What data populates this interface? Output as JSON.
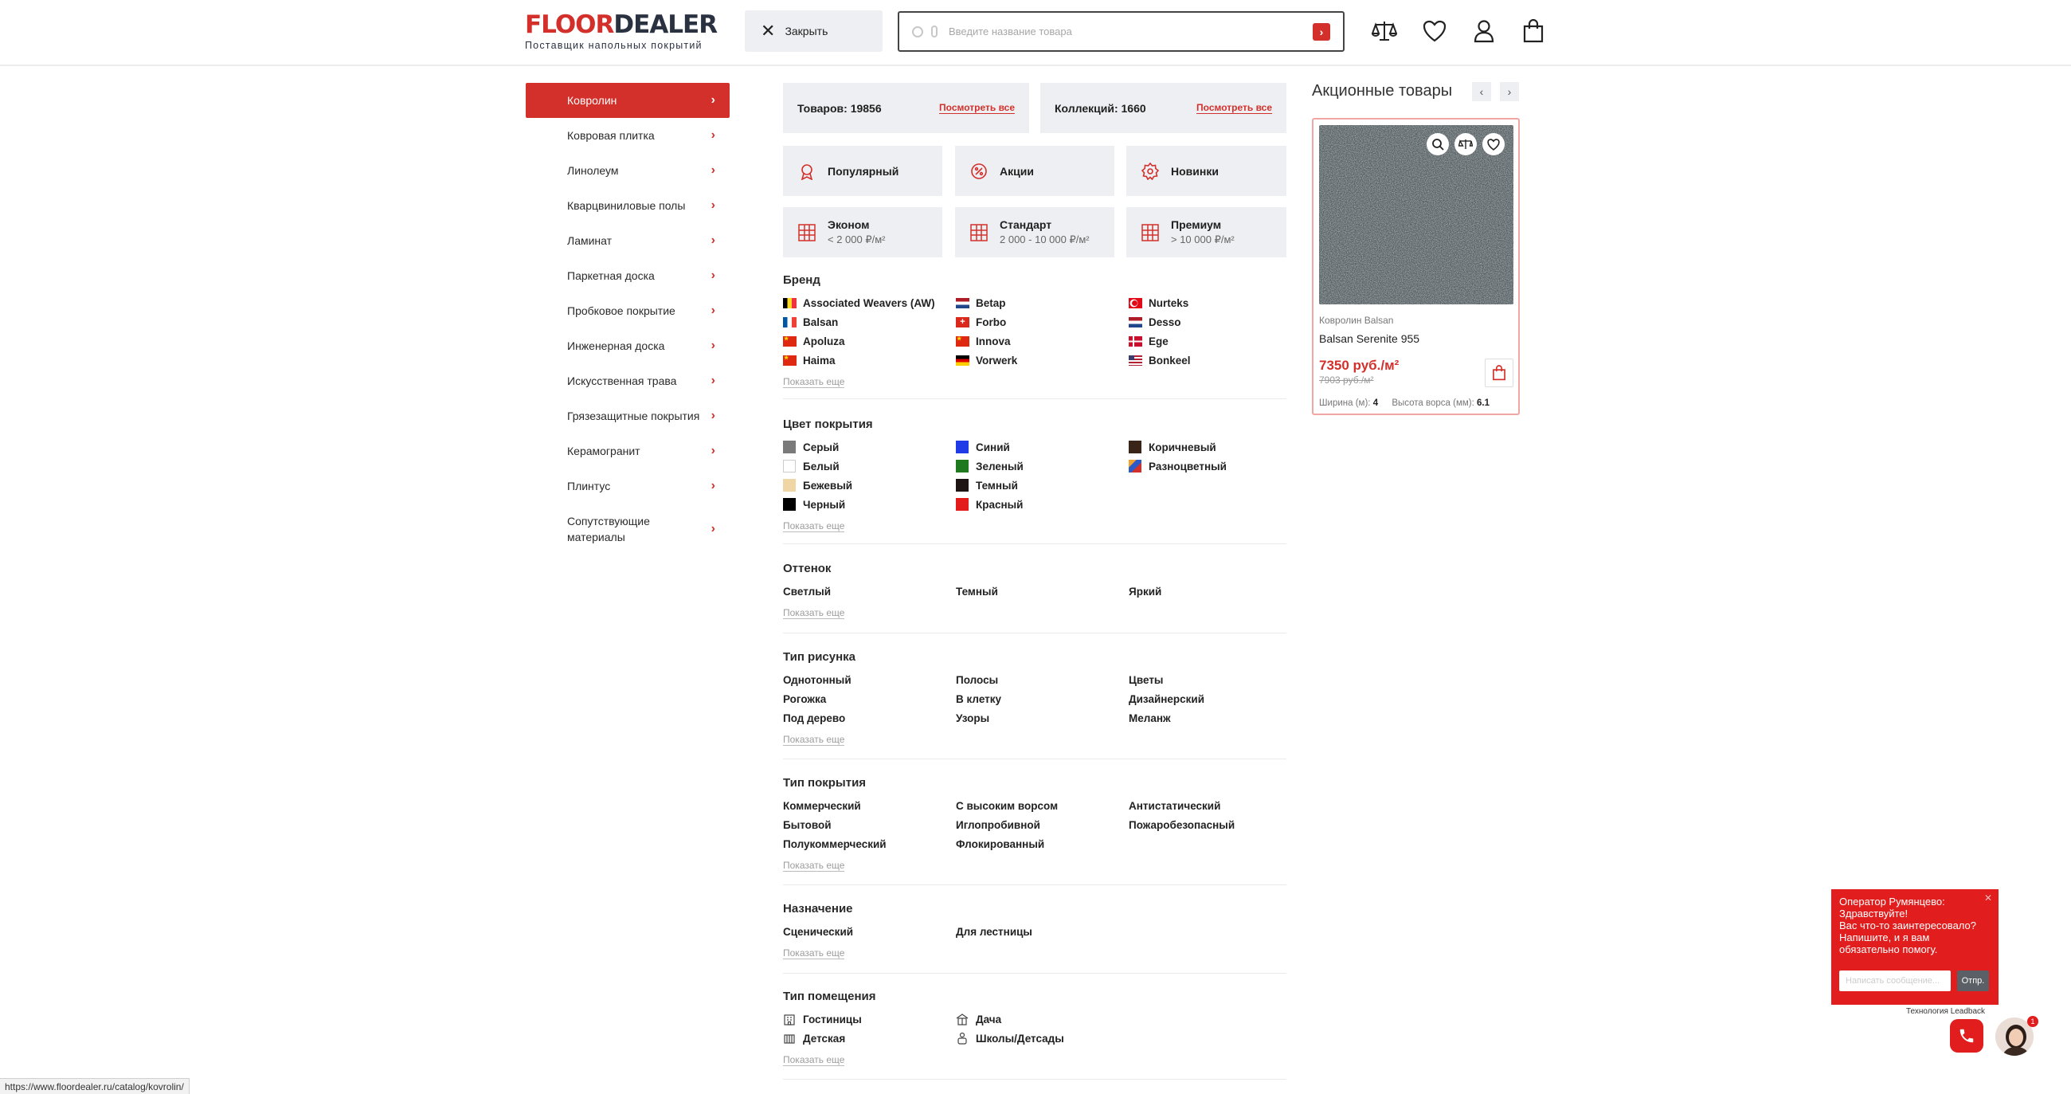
{
  "header": {
    "logo_part1": "FLOOR",
    "logo_part2": "DEALER",
    "tagline": "Поставщик напольных покрытий",
    "close_label": "Закрыть",
    "search_placeholder": "Введите название товара",
    "icons": [
      "compare-icon",
      "heart-icon",
      "user-icon",
      "cart-icon"
    ]
  },
  "sidebar": {
    "items": [
      {
        "label": "Ковролин",
        "active": true
      },
      {
        "label": "Ковровая плитка"
      },
      {
        "label": "Линолеум"
      },
      {
        "label": "Кварцвиниловые полы"
      },
      {
        "label": "Ламинат"
      },
      {
        "label": "Паркетная доска"
      },
      {
        "label": "Пробковое покрытие"
      },
      {
        "label": "Инженерная доска"
      },
      {
        "label": "Искусственная трава"
      },
      {
        "label": "Грязезащитные покрытия"
      },
      {
        "label": "Керамогранит"
      },
      {
        "label": "Плинтус"
      },
      {
        "label": "Сопутствующие материалы"
      }
    ]
  },
  "stats": {
    "goods": "Товаров: 19856",
    "goods_link": "Посмотреть все",
    "collections": "Коллекций: 1660",
    "collections_link": "Посмотреть все"
  },
  "chips": {
    "popular": "Популярный",
    "sales": "Акции",
    "new": "Новинки",
    "econom": "Эконом",
    "econom_sub": "< 2 000 ₽/м²",
    "standard": "Стандарт",
    "standard_sub": "2 000 - 10 000 ₽/м²",
    "premium": "Премиум",
    "premium_sub": "> 10 000 ₽/м²"
  },
  "filters": {
    "show_more": "Показать еще",
    "brand": {
      "title": "Бренд",
      "items": [
        "Associated Weavers (AW)",
        "Betap",
        "Nurteks",
        "Balsan",
        "Forbo",
        "Desso",
        "Apoluza",
        "Innova",
        "Ege",
        "Haima",
        "Vorwerk",
        "Bonkeel"
      ]
    },
    "color": {
      "title": "Цвет покрытия",
      "items": [
        {
          "label": "Серый",
          "color": "#7a7a7a"
        },
        {
          "label": "Синий",
          "color": "#1f3ae6"
        },
        {
          "label": "Коричневый",
          "color": "#3a2418"
        },
        {
          "label": "Белый",
          "color": "#ffffff"
        },
        {
          "label": "Зеленый",
          "color": "#1f7a1f"
        },
        {
          "label": "Разноцветный",
          "color": "multi"
        },
        {
          "label": "Бежевый",
          "color": "#f1d6a5"
        },
        {
          "label": "Темный",
          "color": "#1e1414"
        },
        {
          "label": "Черный",
          "color": "#000000"
        },
        {
          "label": "Красный",
          "color": "#e41b1b"
        }
      ]
    },
    "shade": {
      "title": "Оттенок",
      "items": [
        "Светлый",
        "Темный",
        "Яркий"
      ]
    },
    "pattern": {
      "title": "Тип рисунка",
      "items": [
        "Однотонный",
        "Полосы",
        "Цветы",
        "Рогожка",
        "В клетку",
        "Дизайнерский",
        "Под дерево",
        "Узоры",
        "Меланж"
      ]
    },
    "cover_type": {
      "title": "Тип покрытия",
      "items": [
        "Коммерческий",
        "С высоким ворсом",
        "Антистатический",
        "Бытовой",
        "Иглопробивной",
        "Пожаробезопасный",
        "Полукоммерческий",
        "Флокированный"
      ]
    },
    "purpose": {
      "title": "Назначение",
      "items": [
        "Сценический",
        "Для лестницы"
      ]
    },
    "room": {
      "title": "Тип помещения",
      "items": [
        "Гостиницы",
        "Дача",
        "Детская",
        "Школы/Детсады"
      ]
    }
  },
  "promo": {
    "title": "Акционные товары",
    "card": {
      "category": "Ковролин Balsan",
      "name": "Balsan Serenite 955",
      "price": "7350 руб./м²",
      "old_price": "7903 руб./м²",
      "width_label": "Ширина (м):",
      "width_value": "4",
      "pile_label": "Высота ворса (мм):",
      "pile_value": "6.1"
    }
  },
  "chat": {
    "operator": "Оператор Румянцево:",
    "greeting": "Здравствуйте!",
    "message": "Вас что-то заинтересовало? Напишите, и я вам обязательно помогу.",
    "placeholder": "Написать сообщение...",
    "send": "Отпр.",
    "powered": "Технология Leadback",
    "badge": "1"
  },
  "status_url": "https://www.floordealer.ru/catalog/kovrolin/",
  "colors": {
    "accent": "#d3302b",
    "panel": "#eeeff2",
    "dark": "#2a3140"
  }
}
